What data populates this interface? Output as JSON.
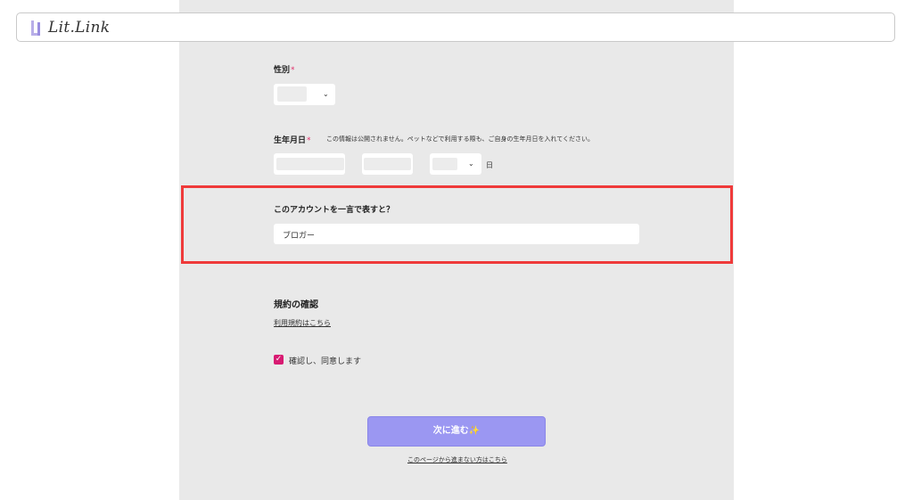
{
  "header": {
    "logo_text": "Lit.Link"
  },
  "form": {
    "gender": {
      "label": "性別",
      "required_mark": "*"
    },
    "birthdate": {
      "label": "生年月日",
      "required_mark": "*",
      "note": "この情報は公開されません。ペットなどで利用する際も、ご自身の生年月日を入れてください。",
      "day_unit": "日"
    },
    "one_word": {
      "label": "このアカウントを一言で表すと？",
      "value": "ブロガー"
    },
    "terms": {
      "title": "規約の確認",
      "link": "利用規約はこちら",
      "agree_label": "確認し、同意します",
      "checked": true
    },
    "next_button": "次に進む✨",
    "skip_link": "このページから進まない方はこちら"
  },
  "colors": {
    "panel_bg": "#e9e9e9",
    "accent": "#9b97f2",
    "checkbox": "#d81b72",
    "highlight_border": "#ef3a3a",
    "required": "#e0306a"
  }
}
